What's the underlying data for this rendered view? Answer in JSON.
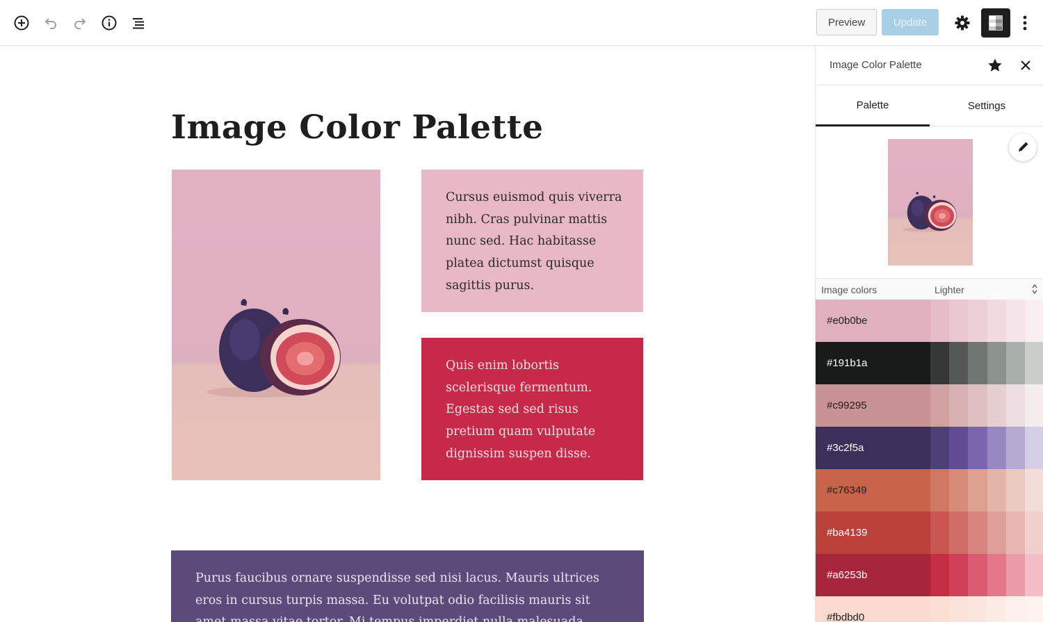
{
  "toolbar": {
    "preview_label": "Preview",
    "update_label": "Update"
  },
  "post": {
    "title": "Image Color Palette",
    "text_pink": "Cursus euismod quis viverra nibh. Cras pulvinar mattis nunc sed. Hac habitasse platea dictumst quisque sagittis purus.",
    "text_red": "Quis enim lobortis scelerisque fermentum. Egestas sed sed risus pretium quam vulputate dignissim suspen disse.",
    "text_purple": "Purus faucibus ornare suspendisse sed nisi lacus. Mauris ultrices eros in cursus turpis massa. Eu volutpat odio facilisis mauris sit amet massa vitae tortor. Mi tempus imperdiet nulla malesuada pellentesque elit eget."
  },
  "sidebar": {
    "title": "Image Color Palette",
    "tabs": [
      "Palette",
      "Settings"
    ],
    "image_colors_label": "Image colors",
    "variant_selected": "Lighter",
    "palette": [
      {
        "hex": "#e0b0be",
        "text_color": "#1e1e1e",
        "shades": [
          "#e5bcc8",
          "#e9c6d0",
          "#edd0d8",
          "#f1dae0",
          "#f5e4e9",
          "#f9eef1"
        ]
      },
      {
        "hex": "#191b1a",
        "text_color": "#ffffff",
        "shades": [
          "#353836",
          "#545957",
          "#6f7672",
          "#8c938f",
          "#a9b0ac",
          "#c9cecb"
        ]
      },
      {
        "hex": "#c99295",
        "text_color": "#1e1e1e",
        "shades": [
          "#d1a1a4",
          "#d8b1b3",
          "#dfc0c2",
          "#e6cfd1",
          "#eddee0",
          "#f4eced"
        ]
      },
      {
        "hex": "#3c2f5a",
        "text_color": "#ffffff",
        "shades": [
          "#4f3f78",
          "#614c93",
          "#7a66ad",
          "#9888c0",
          "#b6aad3",
          "#d4cde6"
        ]
      },
      {
        "hex": "#c76349",
        "text_color": "#1e1e1e",
        "shades": [
          "#cf7862",
          "#d68c79",
          "#dca190",
          "#e3b5a8",
          "#eacac0",
          "#f2ded8"
        ]
      },
      {
        "hex": "#ba4139",
        "text_color": "#ffffff",
        "shades": [
          "#c9564f",
          "#d16d67",
          "#d8857f",
          "#e09e99",
          "#e8b7b3",
          "#f0d1ce"
        ]
      },
      {
        "hex": "#a6253b",
        "text_color": "#ffffff",
        "shades": [
          "#c52d47",
          "#d23f58",
          "#db5b71",
          "#e3788b",
          "#eb9aa8",
          "#f3bec7"
        ]
      },
      {
        "hex": "#fbdbd0",
        "text_color": "#1e1e1e",
        "shades": [
          "#fbdfd5",
          "#fce3da",
          "#fce7e0",
          "#fdebe5",
          "#fdefea",
          "#fef3ef"
        ]
      }
    ]
  }
}
